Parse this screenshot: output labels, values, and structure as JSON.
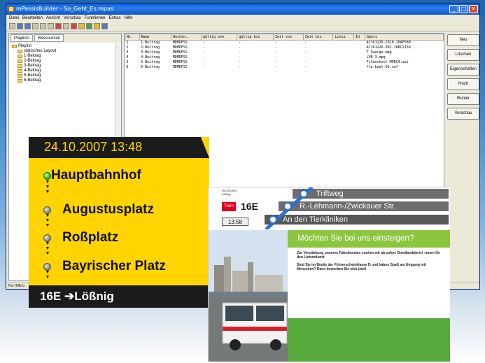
{
  "window": {
    "title": "mPassisBuilder - So_Geht_Es.mpas",
    "menu": [
      "Datei",
      "Bearbeiten",
      "Ansicht",
      "Vorschau",
      "Funktionen",
      "Extras",
      "Hilfe"
    ],
    "status": "Für Hilfe b"
  },
  "left_panel": {
    "tabs": [
      "Playlists",
      "Ressourcen"
    ],
    "tree": [
      "Playlist",
      "statisches Layout",
      "1-Beitrag",
      "2-Beitrag",
      "3-Beitrag",
      "4-Beitrag",
      "5-Beitrag",
      "6-Beitrag"
    ]
  },
  "grid": {
    "columns": [
      "Nr.",
      "Name",
      "Wochen..",
      "gültig von",
      "gültig bis",
      "Zeit von",
      "Zeit bis",
      "Linie",
      "Id",
      "Spots"
    ],
    "rows": [
      [
        "1",
        "1-Beitrag",
        "MDMDFSS",
        "",
        "",
        "",
        "",
        "",
        "",
        "AC161226-2010-10AF580"
      ],
      [
        "2",
        "2-Beitrag",
        "MDMDFSS",
        "",
        "",
        "",
        "",
        "",
        "",
        "AC161226-002-16BC2158..."
      ],
      [
        "3",
        "3-Beitrag",
        "MDMDFSS",
        "",
        "",
        "",
        "",
        "",
        "",
        "T_Swarge.mpg"
      ],
      [
        "4",
        "4-Beitrag",
        "MDMDFSS",
        "",
        "",
        "",
        "",
        "",
        "",
        "LVB_3.mpg"
      ],
      [
        "5",
        "5-Beitrag",
        "MDMDFSS",
        "",
        "",
        "",
        "",
        "",
        "",
        "Filmschool_MPEG4.avi"
      ],
      [
        "6",
        "6-Beitrag",
        "MDMDFSS",
        "",
        "",
        "",
        "",
        "",
        "",
        "fla-bowl-01.swf"
      ]
    ]
  },
  "right_buttons": [
    "Neu",
    "Löschen",
    "Eigenschaften",
    "Hoch",
    "Runter",
    "Vorschau"
  ],
  "yellow_display": {
    "datetime": "24.10.2007  13:48",
    "stops": [
      "Hauptbahnhof",
      "Augustusplatz",
      "Roßplatz",
      "Bayrischer Platz"
    ],
    "destination": "16E ➔Lößnig",
    "colors": {
      "bg": "#ffd400",
      "bar": "#1b1b1b",
      "current": "#34b63a"
    }
  },
  "tram_display": {
    "richtung_label": "RICHTUNG:",
    "richtung_value": "Lößnig",
    "tram_badge": "Tram",
    "line": "16E",
    "time": "13:58",
    "stops": [
      "Triftweg",
      "R.-Lehmann-/Zwickauer Str.",
      "An den Tierkliniken"
    ],
    "ad_title": "Möchten Sie bei uns einsteigen?",
    "ad_text1": "Zur Verstärkung unseres Fahrdienstes suchen wir ab sofort Omnibusfahrer/ -innen für den Liniendienst",
    "ad_text2": "Sind Sie im Besitz der Führerscheinklasse D und haben Spaß am Umgang mit Menschen? Dann bewerben Sie sich jetzt!",
    "colors": {
      "green": "#8cc63f",
      "band": "#6d6d6d",
      "accent": "#e2001a"
    }
  }
}
